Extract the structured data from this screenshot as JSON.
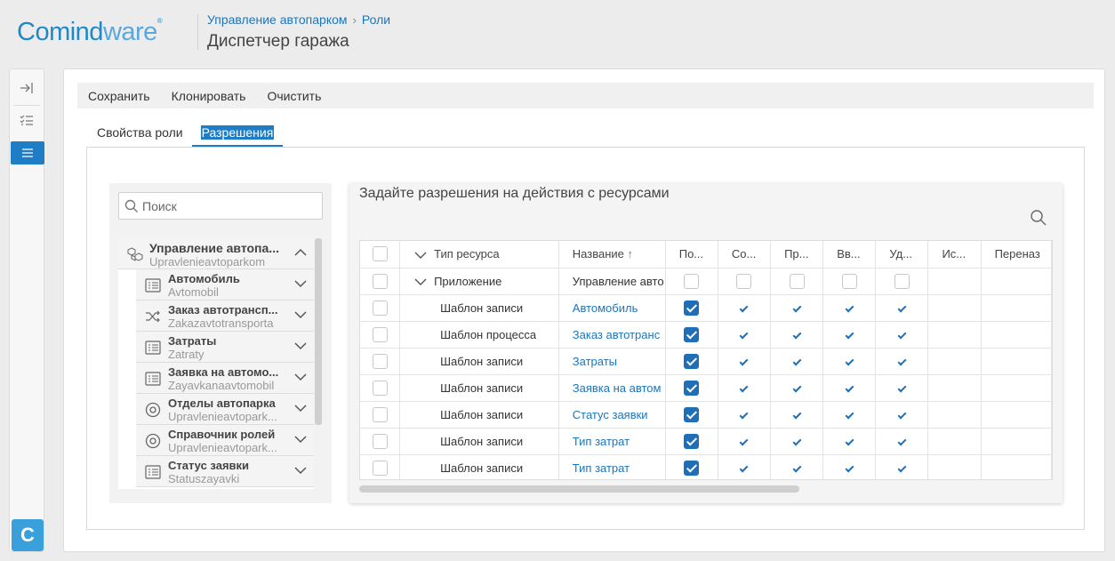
{
  "header": {
    "logo_main": "Comind",
    "logo_accent": "ware",
    "logo_mark": "®",
    "breadcrumb": [
      "Управление автопарком",
      "Роли"
    ],
    "title": "Диспетчер гаража"
  },
  "rail": {
    "logo_letter": "C"
  },
  "toolbar": {
    "save": "Сохранить",
    "clone": "Клонировать",
    "clear": "Очистить"
  },
  "tabs": {
    "role_props": "Свойства роли",
    "permissions": "Разрешения"
  },
  "tree": {
    "search_placeholder": "Поиск",
    "root": {
      "title": "Управление автопа...",
      "alias": "Upravlenieavtoparkom"
    },
    "items": [
      {
        "title": "Автомобиль",
        "alias": "Avtomobil",
        "icon": "list-icon"
      },
      {
        "title": "Заказ автотрансп...",
        "alias": "Zakazavtotransporta",
        "icon": "process-icon"
      },
      {
        "title": "Затраты",
        "alias": "Zatraty",
        "icon": "list-icon"
      },
      {
        "title": "Заявка на автомо...",
        "alias": "Zayavkanaavtomobil",
        "icon": "list-icon"
      },
      {
        "title": "Отделы автопарка",
        "alias": "Upravlenieavtopark...",
        "icon": "circle-icon"
      },
      {
        "title": "Справочник ролей",
        "alias": "Upravlenieavtopark...",
        "icon": "circle-icon"
      },
      {
        "title": "Статус заявки",
        "alias": "Statuszayavki",
        "icon": "list-icon"
      }
    ]
  },
  "permissions": {
    "title": "Задайте разрешения на действия с ресурсами",
    "columns": [
      "Тип ресурса",
      "Название",
      "По...",
      "Со...",
      "Пр...",
      "Вв...",
      "Уд...",
      "Ис...",
      "Переназ"
    ],
    "rows": [
      {
        "type": "Приложение",
        "name": "Управление авто",
        "is_group": true,
        "checked": false
      },
      {
        "type": "Шаблон записи",
        "name": "Автомобиль",
        "is_group": false,
        "checked": true
      },
      {
        "type": "Шаблон процесса",
        "name": "Заказ автотранс",
        "is_group": false,
        "checked": true
      },
      {
        "type": "Шаблон записи",
        "name": "Затраты",
        "is_group": false,
        "checked": true
      },
      {
        "type": "Шаблон записи",
        "name": "Заявка на автом",
        "is_group": false,
        "checked": true
      },
      {
        "type": "Шаблон записи",
        "name": "Статус заявки",
        "is_group": false,
        "checked": true
      },
      {
        "type": "Шаблон записи",
        "name": "Тип затрат",
        "is_group": false,
        "checked": true
      },
      {
        "type": "Шаблон записи",
        "name": "Тип затрат",
        "is_group": false,
        "checked": true
      }
    ]
  },
  "colors": {
    "accent": "#1e7dc4",
    "link": "#1b75bc",
    "check": "#1e6fb8"
  }
}
